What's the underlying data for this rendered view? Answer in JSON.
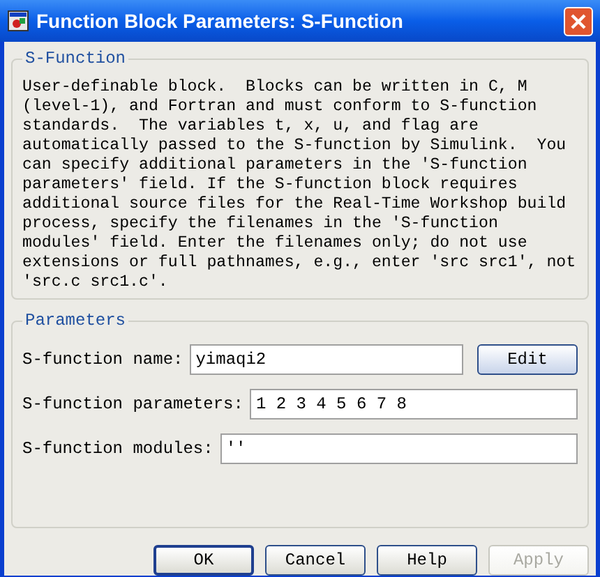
{
  "window": {
    "title": "Function Block Parameters: S-Function"
  },
  "description_group": {
    "title": "S-Function",
    "text": "User-definable block.  Blocks can be written in C, M\n(level-1), and Fortran and must conform to S-function\nstandards.  The variables t, x, u, and flag are\nautomatically passed to the S-function by Simulink.  You\ncan specify additional parameters in the 'S-function\nparameters' field. If the S-function block requires\nadditional source files for the Real-Time Workshop build\nprocess, specify the filenames in the 'S-function\nmodules' field. Enter the filenames only; do not use\nextensions or full pathnames, e.g., enter 'src src1', not\n'src.c src1.c'."
  },
  "parameters_group": {
    "title": "Parameters",
    "fields": [
      {
        "label": "S-function name:",
        "value": "yimaqi2",
        "button": "Edit"
      },
      {
        "label": "S-function parameters:",
        "value": "1 2 3 4 5 6 7 8"
      },
      {
        "label": "S-function modules:",
        "value": "''"
      }
    ]
  },
  "buttons": [
    {
      "label": "OK",
      "default": true,
      "disabled": false
    },
    {
      "label": "Cancel",
      "default": false,
      "disabled": false
    },
    {
      "label": "Help",
      "default": false,
      "disabled": false
    },
    {
      "label": "Apply",
      "default": false,
      "disabled": true
    }
  ]
}
